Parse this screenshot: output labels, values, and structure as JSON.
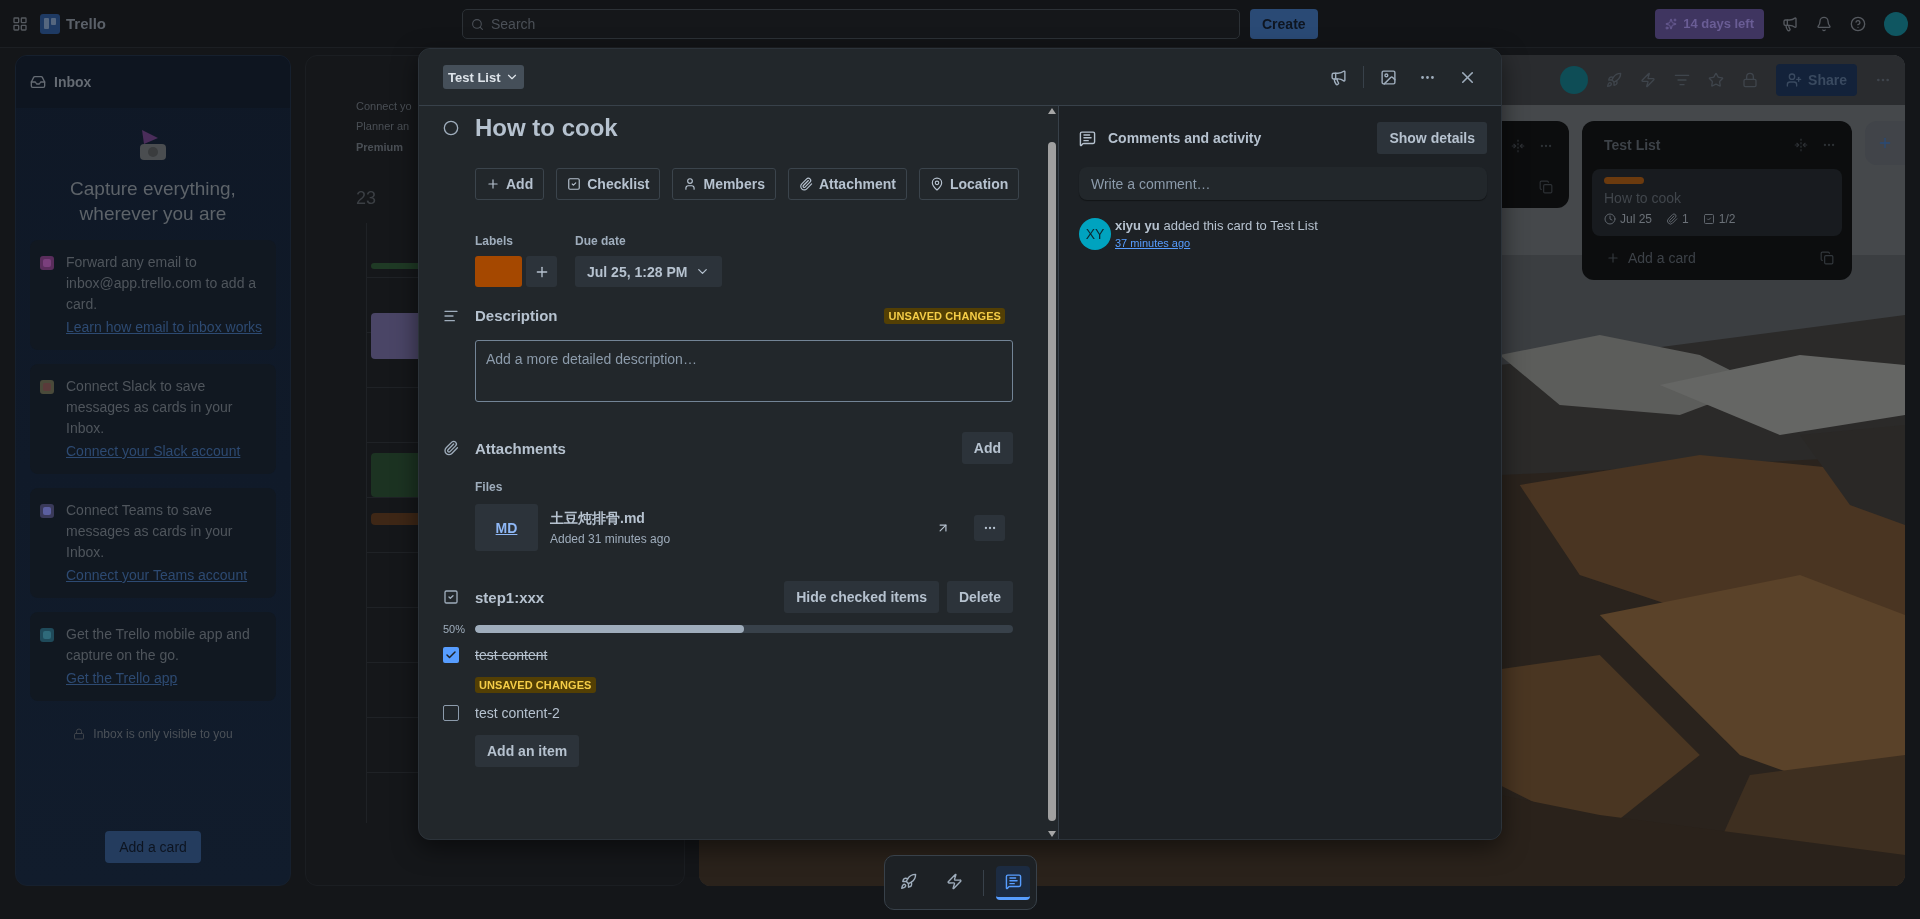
{
  "top_bar": {
    "app_name": "Trello",
    "search": {
      "placeholder": "Search"
    },
    "create_button": "Create",
    "trial_badge": "14 days left"
  },
  "inbox": {
    "title": "Inbox",
    "heading": "Capture everything, wherever you are",
    "tips": [
      {
        "kind": "email",
        "text": "Forward any email to inbox@app.trello.com to add a card.",
        "link": "Learn how email to inbox works"
      },
      {
        "kind": "slack",
        "text": "Connect Slack to save messages as cards in your Inbox.",
        "link": "Connect your Slack account"
      },
      {
        "kind": "teams",
        "text": "Connect Teams to save messages as cards in your Inbox.",
        "link": "Connect your Teams account"
      },
      {
        "kind": "mobile",
        "text": "Get the Trello mobile app and capture on the go.",
        "link": "Get the Trello app"
      }
    ],
    "privacy_note": "Inbox is only visible to you",
    "add_card_button": "Add a card"
  },
  "planner": {
    "intro_lines": [
      "Connect yo",
      "Planner an"
    ],
    "premium": "Premium",
    "day": "23",
    "events": [
      {
        "color": "#1f3a25"
      },
      {
        "color": "#4a4566"
      },
      {
        "color": "#1c3322"
      },
      {
        "color": "#3e2716"
      }
    ]
  },
  "board": {
    "share_button": "Share",
    "lists": [
      {
        "title": "Test List",
        "cards": [
          {
            "title": "How to cook",
            "labels": [
              {
                "color": "#6b3a0e"
              }
            ],
            "due": "Jul 25",
            "attachments": "1",
            "checklist": "1/2"
          }
        ],
        "add_card": "Add a card"
      }
    ]
  },
  "card_modal": {
    "list_name": "Test List",
    "title": "How to cook",
    "actions": [
      {
        "kind": "add",
        "label": "Add"
      },
      {
        "kind": "checklist",
        "label": "Checklist"
      },
      {
        "kind": "members",
        "label": "Members"
      },
      {
        "kind": "attachment",
        "label": "Attachment"
      },
      {
        "kind": "location",
        "label": "Location"
      }
    ],
    "labels_heading": "Labels",
    "labels": [
      {
        "color": "#a54800"
      }
    ],
    "due_heading": "Due date",
    "due_date": "Jul 25, 1:28 PM",
    "description": {
      "heading": "Description",
      "badge": "UNSAVED CHANGES",
      "placeholder": "Add a more detailed description…"
    },
    "attachments": {
      "heading": "Attachments",
      "add_button": "Add",
      "files_heading": "Files",
      "files": [
        {
          "thumb": "MD",
          "name": "土豆炖排骨.md",
          "added": "Added 31 minutes ago"
        }
      ]
    },
    "checklist": {
      "title": "step1:xxx",
      "hide_button": "Hide checked items",
      "delete_button": "Delete",
      "percent": "50%",
      "level": 0.5,
      "items": [
        {
          "text": "test content",
          "checked": true,
          "badge": "UNSAVED CHANGES"
        },
        {
          "text": "test content-2",
          "checked": false
        }
      ],
      "add_item_button": "Add an item"
    },
    "activity": {
      "heading": "Comments and activity",
      "show_details_button": "Show details",
      "comment": {
        "placeholder": "Write a comment…"
      },
      "entries": [
        {
          "initials": "XY",
          "user": "xiyu yu",
          "action": "added this card to Test List",
          "time": "37 minutes ago"
        }
      ]
    }
  },
  "dock": [
    {
      "kind": "rocket",
      "selected": false
    },
    {
      "kind": "lightning",
      "selected": false
    },
    {
      "kind": "chat",
      "selected": true
    }
  ]
}
